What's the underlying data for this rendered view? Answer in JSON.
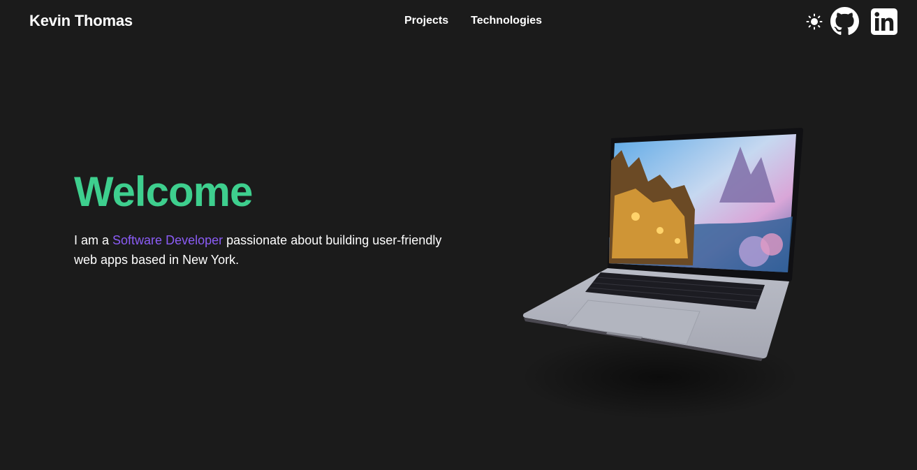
{
  "header": {
    "site_name": "Kevin Thomas",
    "nav": [
      {
        "label": "Projects"
      },
      {
        "label": "Technologies"
      }
    ],
    "icons": {
      "theme": "sun-icon",
      "github": "github-icon",
      "linkedin": "linkedin-icon"
    }
  },
  "hero": {
    "title": "Welcome",
    "intro_prefix": "I am a ",
    "intro_highlight": "Software Developer",
    "intro_suffix": " passionate about building user-friendly web apps based in New York.",
    "image": "laptop-illustration"
  },
  "colors": {
    "background": "#1b1b1b",
    "title_green": "#3ecf8e",
    "highlight_purple": "#8b5cf6",
    "text": "#ffffff"
  }
}
